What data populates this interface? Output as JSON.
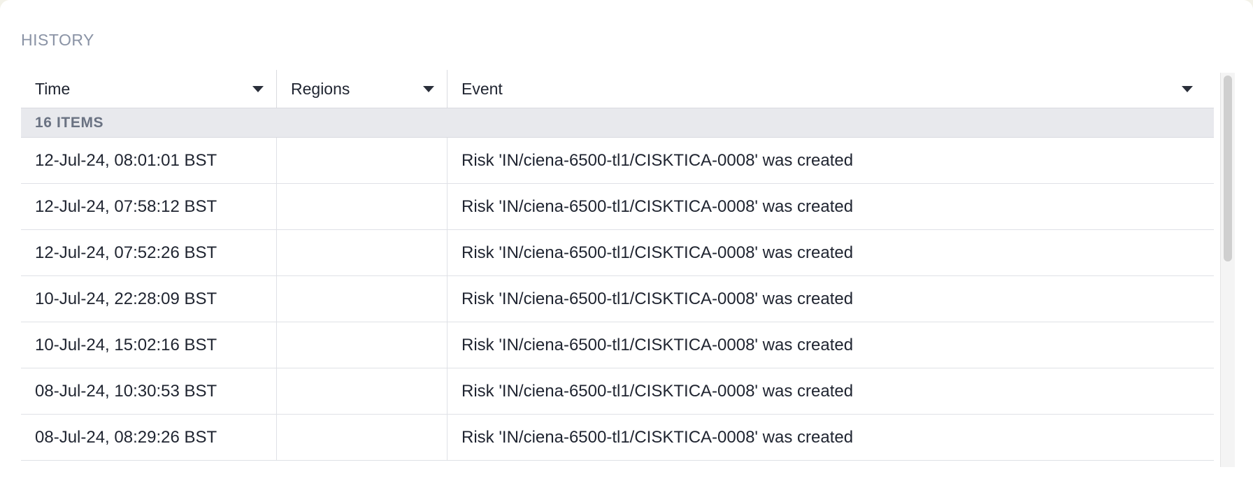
{
  "section": {
    "title": "HISTORY"
  },
  "table": {
    "columns": [
      {
        "label": "Time"
      },
      {
        "label": "Regions"
      },
      {
        "label": "Event"
      }
    ],
    "group_label": "16 ITEMS",
    "rows": [
      {
        "time": "12-Jul-24, 08:01:01 BST",
        "regions": "",
        "event": "Risk 'IN/ciena-6500-tl1/CISKTICA-0008' was created"
      },
      {
        "time": "12-Jul-24, 07:58:12 BST",
        "regions": "",
        "event": "Risk 'IN/ciena-6500-tl1/CISKTICA-0008' was created"
      },
      {
        "time": "12-Jul-24, 07:52:26 BST",
        "regions": "",
        "event": "Risk 'IN/ciena-6500-tl1/CISKTICA-0008' was created"
      },
      {
        "time": "10-Jul-24, 22:28:09 BST",
        "regions": "",
        "event": "Risk 'IN/ciena-6500-tl1/CISKTICA-0008' was created"
      },
      {
        "time": "10-Jul-24, 15:02:16 BST",
        "regions": "",
        "event": "Risk 'IN/ciena-6500-tl1/CISKTICA-0008' was created"
      },
      {
        "time": "08-Jul-24, 10:30:53 BST",
        "regions": "",
        "event": "Risk 'IN/ciena-6500-tl1/CISKTICA-0008' was created"
      },
      {
        "time": "08-Jul-24, 08:29:26 BST",
        "regions": "",
        "event": "Risk 'IN/ciena-6500-tl1/CISKTICA-0008' was created"
      }
    ]
  },
  "icons": {
    "sort": "chevron-down-icon"
  }
}
